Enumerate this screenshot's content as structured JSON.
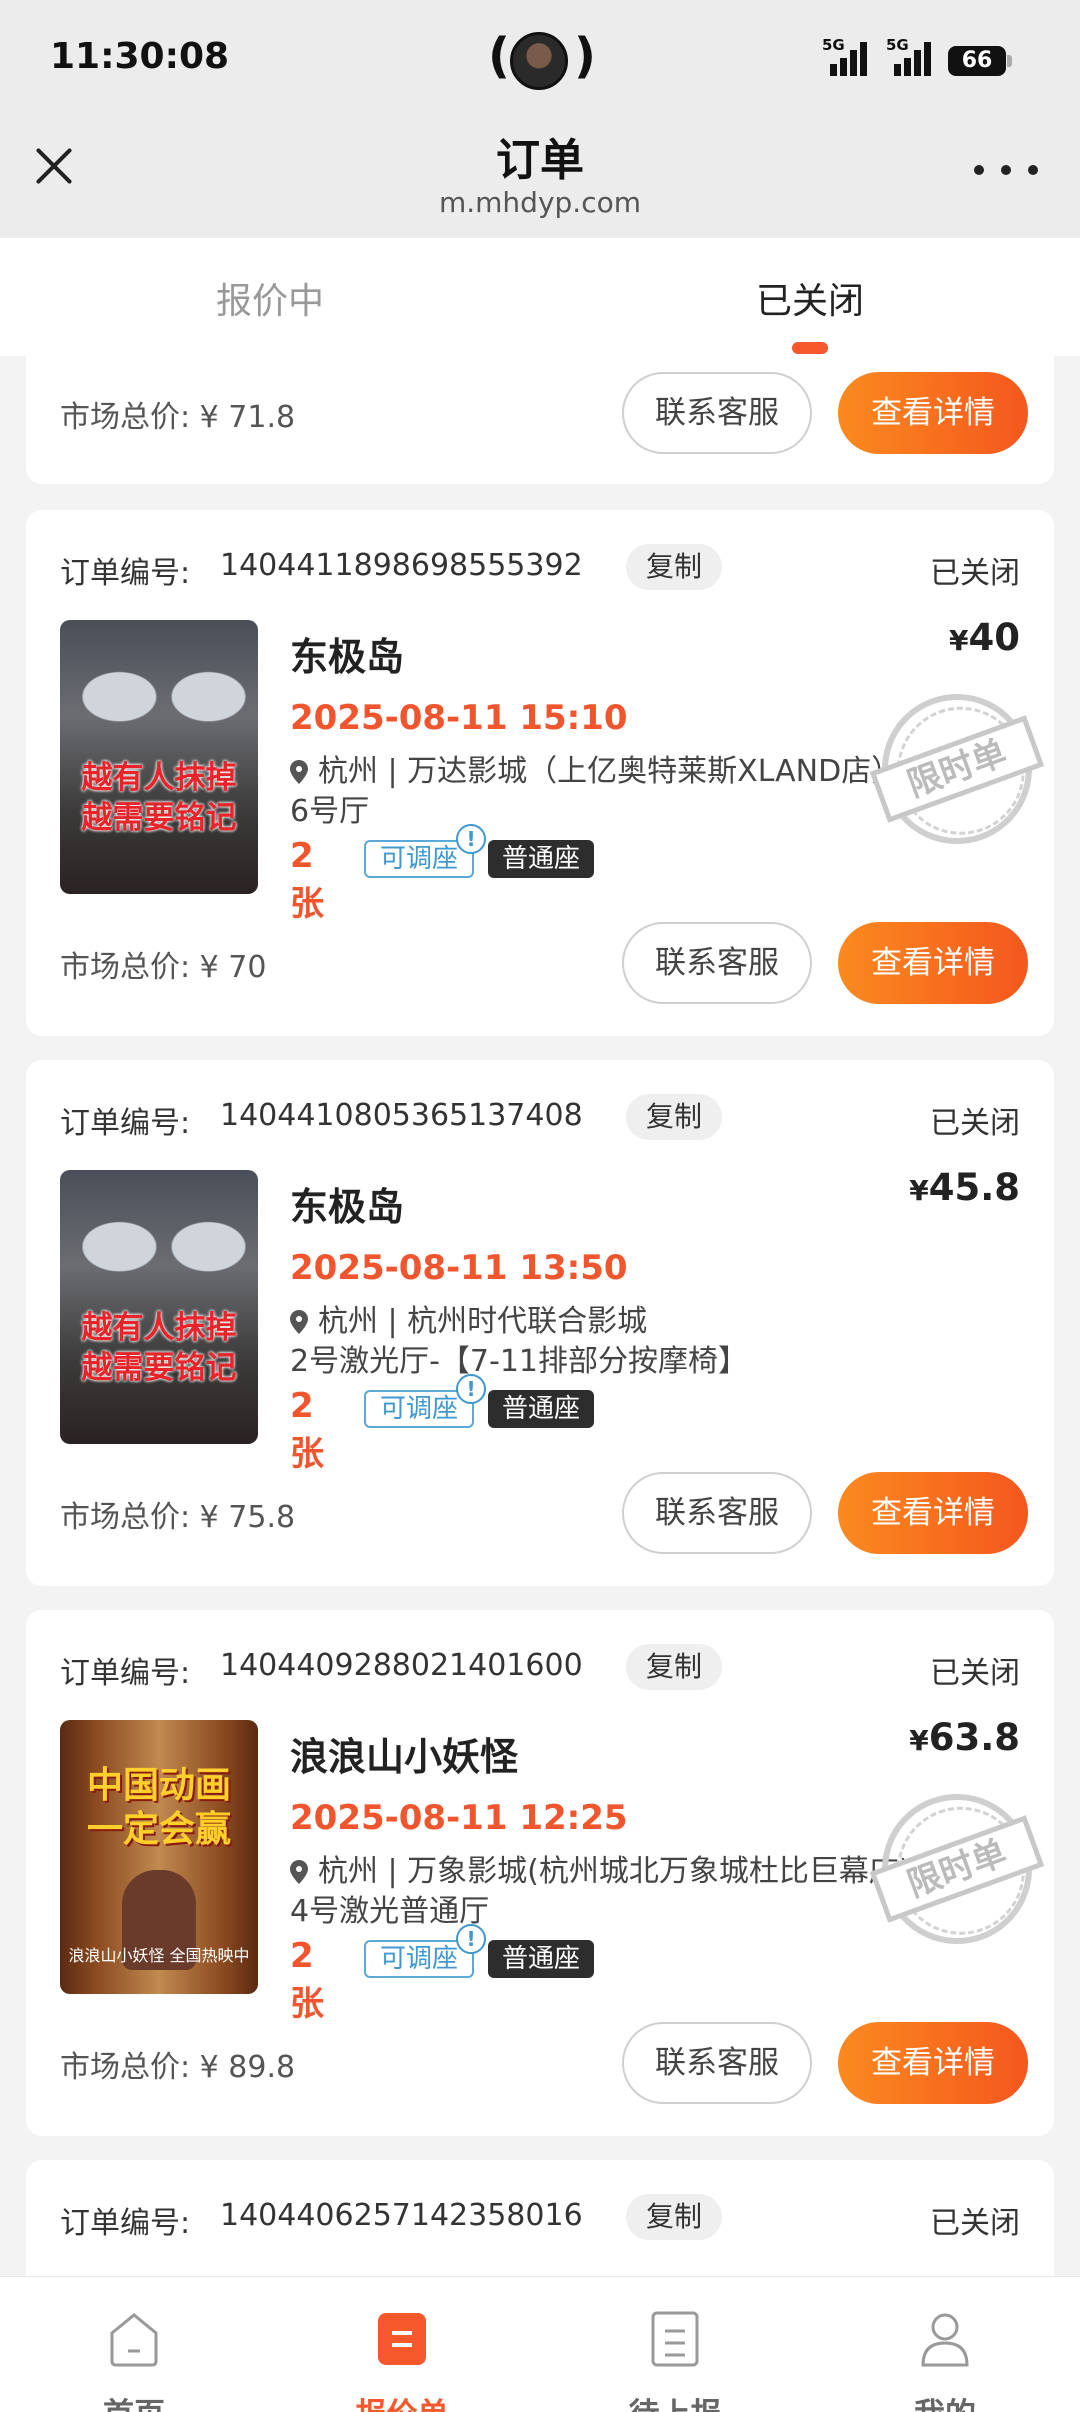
{
  "status_bar": {
    "time": "11:30:08",
    "battery": "66",
    "net1": "5G",
    "net2": "5G"
  },
  "header": {
    "title": "订单",
    "domain": "m.mhdyp.com"
  },
  "tabs": [
    {
      "label": "报价中"
    },
    {
      "label": "已关闭"
    }
  ],
  "partial_top": {
    "market_label": "市场总价:",
    "market_value": "¥ 71.8"
  },
  "buttons": {
    "contact": "联系客服",
    "detail": "查看详情",
    "copy": "复制"
  },
  "labels": {
    "order_no": "订单编号:",
    "market": "市场总价:",
    "adjustable": "可调座",
    "info": "!"
  },
  "orders": [
    {
      "order_no": "1404411898698555392",
      "status": "已关闭",
      "film": "东极岛",
      "price_symbol": "¥",
      "price": "40",
      "showtime": "2025-08-11 15:10",
      "location": "杭州 | 万达影城（上亿奥特莱斯XLAND店）",
      "hall": "6号厅",
      "count": "2张",
      "seat": "普通座",
      "market_value": "¥ 70",
      "stamp": "限时单",
      "poster_text": [
        "越有人抹掉",
        "越需要铭记"
      ]
    },
    {
      "order_no": "1404410805365137408",
      "status": "已关闭",
      "film": "东极岛",
      "price_symbol": "¥",
      "price": "45.8",
      "showtime": "2025-08-11 13:50",
      "location": "杭州 | 杭州时代联合影城",
      "hall": "2号激光厅-【7-11排部分按摩椅】",
      "count": "2张",
      "seat": "普通座",
      "market_value": "¥ 75.8",
      "poster_text": [
        "越有人抹掉",
        "越需要铭记"
      ]
    },
    {
      "order_no": "1404409288021401600",
      "status": "已关闭",
      "film": "浪浪山小妖怪",
      "price_symbol": "¥",
      "price": "63.8",
      "showtime": "2025-08-11 12:25",
      "location": "杭州 | 万象影城(杭州城北万象城杜比巨幕店)",
      "hall": "4号激光普通厅",
      "count": "2张",
      "seat": "普通座",
      "market_value": "¥ 89.8",
      "stamp": "限时单",
      "poster_text": [
        "中国动画",
        "一定会赢"
      ],
      "poster_sub": "浪浪山小妖怪 全国热映中"
    },
    {
      "order_no": "1404406257142358016",
      "status": "已关闭"
    }
  ],
  "bottom_nav": [
    {
      "label": "首页",
      "icon": "home-icon"
    },
    {
      "label": "报价单",
      "icon": "quote-icon"
    },
    {
      "label": "待上报",
      "icon": "report-icon"
    },
    {
      "label": "我的",
      "icon": "profile-icon"
    }
  ],
  "colors": {
    "accent": "#f5582b",
    "price_red": "#f0552d",
    "tag_blue": "#3f98cf"
  }
}
